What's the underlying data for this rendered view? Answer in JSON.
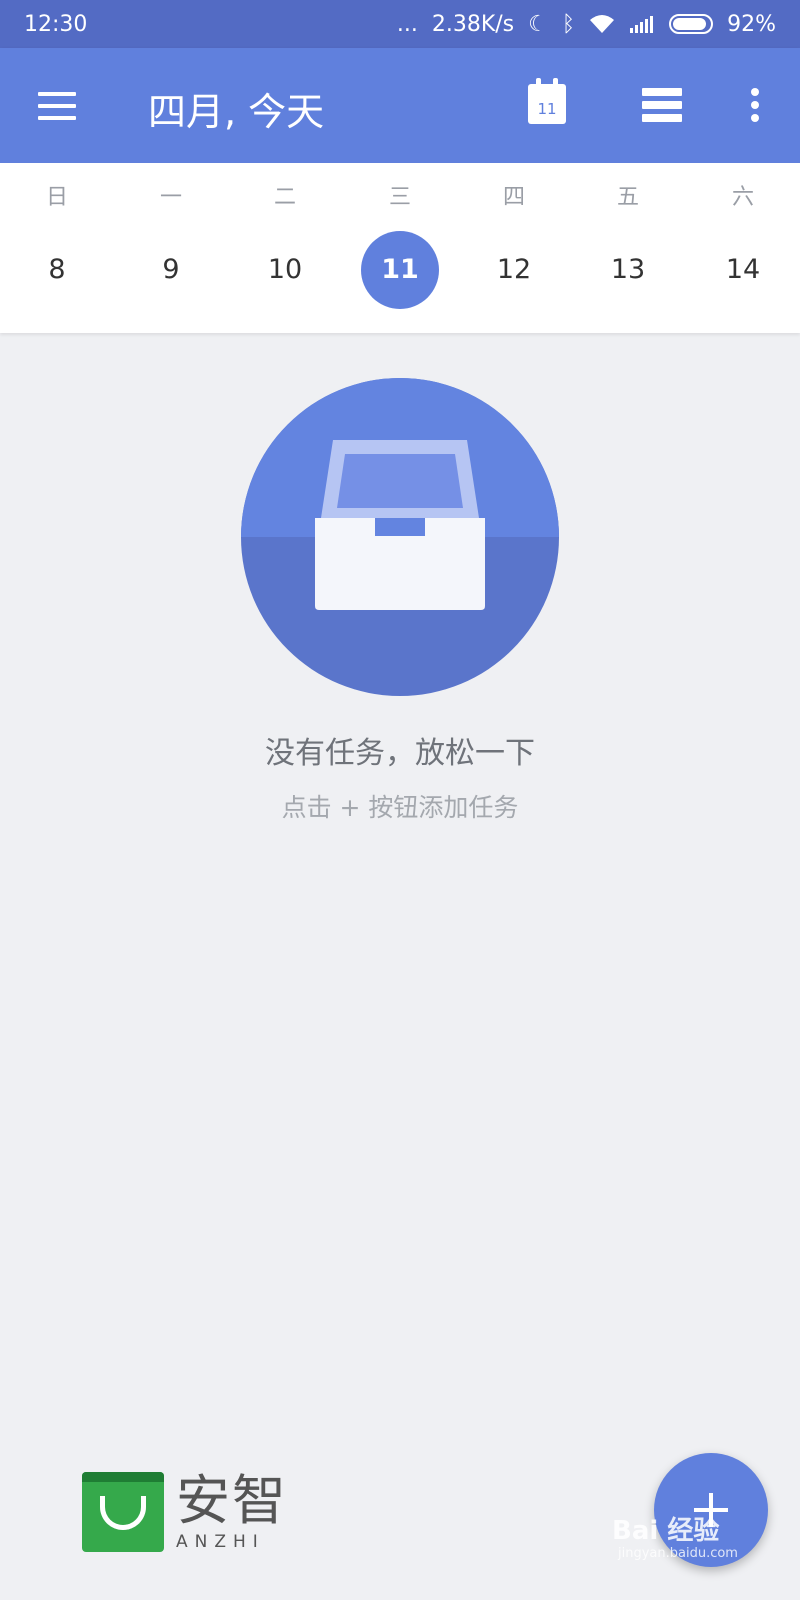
{
  "status_bar": {
    "time": "12:30",
    "dots": "...",
    "speed": "2.38K/s",
    "battery": "92%",
    "battery_level": 0.92
  },
  "app_bar": {
    "title": "四月, 今天",
    "calendar_day": "11"
  },
  "week": {
    "weekdays": [
      "日",
      "一",
      "二",
      "三",
      "四",
      "五",
      "六"
    ],
    "days": [
      "8",
      "9",
      "10",
      "11",
      "12",
      "13",
      "14"
    ],
    "selected_day": "11"
  },
  "empty_state": {
    "title": "没有任务，放松一下",
    "hint": "点击 + 按钮添加任务"
  },
  "brand": {
    "name_cn": "安智",
    "name_en": "ANZHI"
  },
  "watermark": {
    "text": "Bai 经验",
    "url": "jingyan.baidu.com"
  },
  "colors": {
    "accent": "#6080dd",
    "status_bar": "#536bc4",
    "background": "#eff0f3",
    "brand_green": "#35a94b"
  }
}
